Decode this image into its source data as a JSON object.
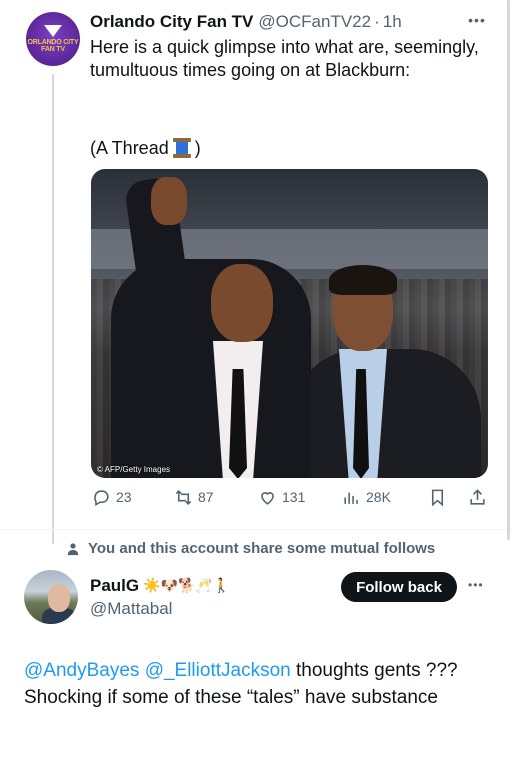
{
  "tweet": {
    "author_name": "Orlando City Fan TV",
    "author_handle": "@OCFanTV22",
    "separator": "·",
    "time": "1h",
    "avatar_text": "ORLANDO CITY FAN TV",
    "text": "Here is a quick glimpse into what are, seemingly, tumultuous times going on at Blackburn:",
    "thread_prefix": "(A Thread",
    "thread_suffix": ")",
    "thread_icon": "spool-of-thread-icon",
    "image_credit": "© AFP/Getty Images",
    "actions": {
      "replies": "23",
      "reposts": "87",
      "likes": "131",
      "views": "28K"
    }
  },
  "mutual_notice": "You and this account share some mutual follows",
  "reply": {
    "author_name": "PaulG",
    "author_emojis": "☀️🐶🐕🥂🚶",
    "author_handle": "@Mattabal",
    "follow_label": "Follow back",
    "mention1": "@AndyBayes",
    "mention2": "@_ElliottJackson",
    "text": " thoughts gents ??? Shocking if some of these “tales” have substance"
  },
  "colors": {
    "accent": "#1d9bf0",
    "text": "#0f1419",
    "secondary": "#536471"
  }
}
